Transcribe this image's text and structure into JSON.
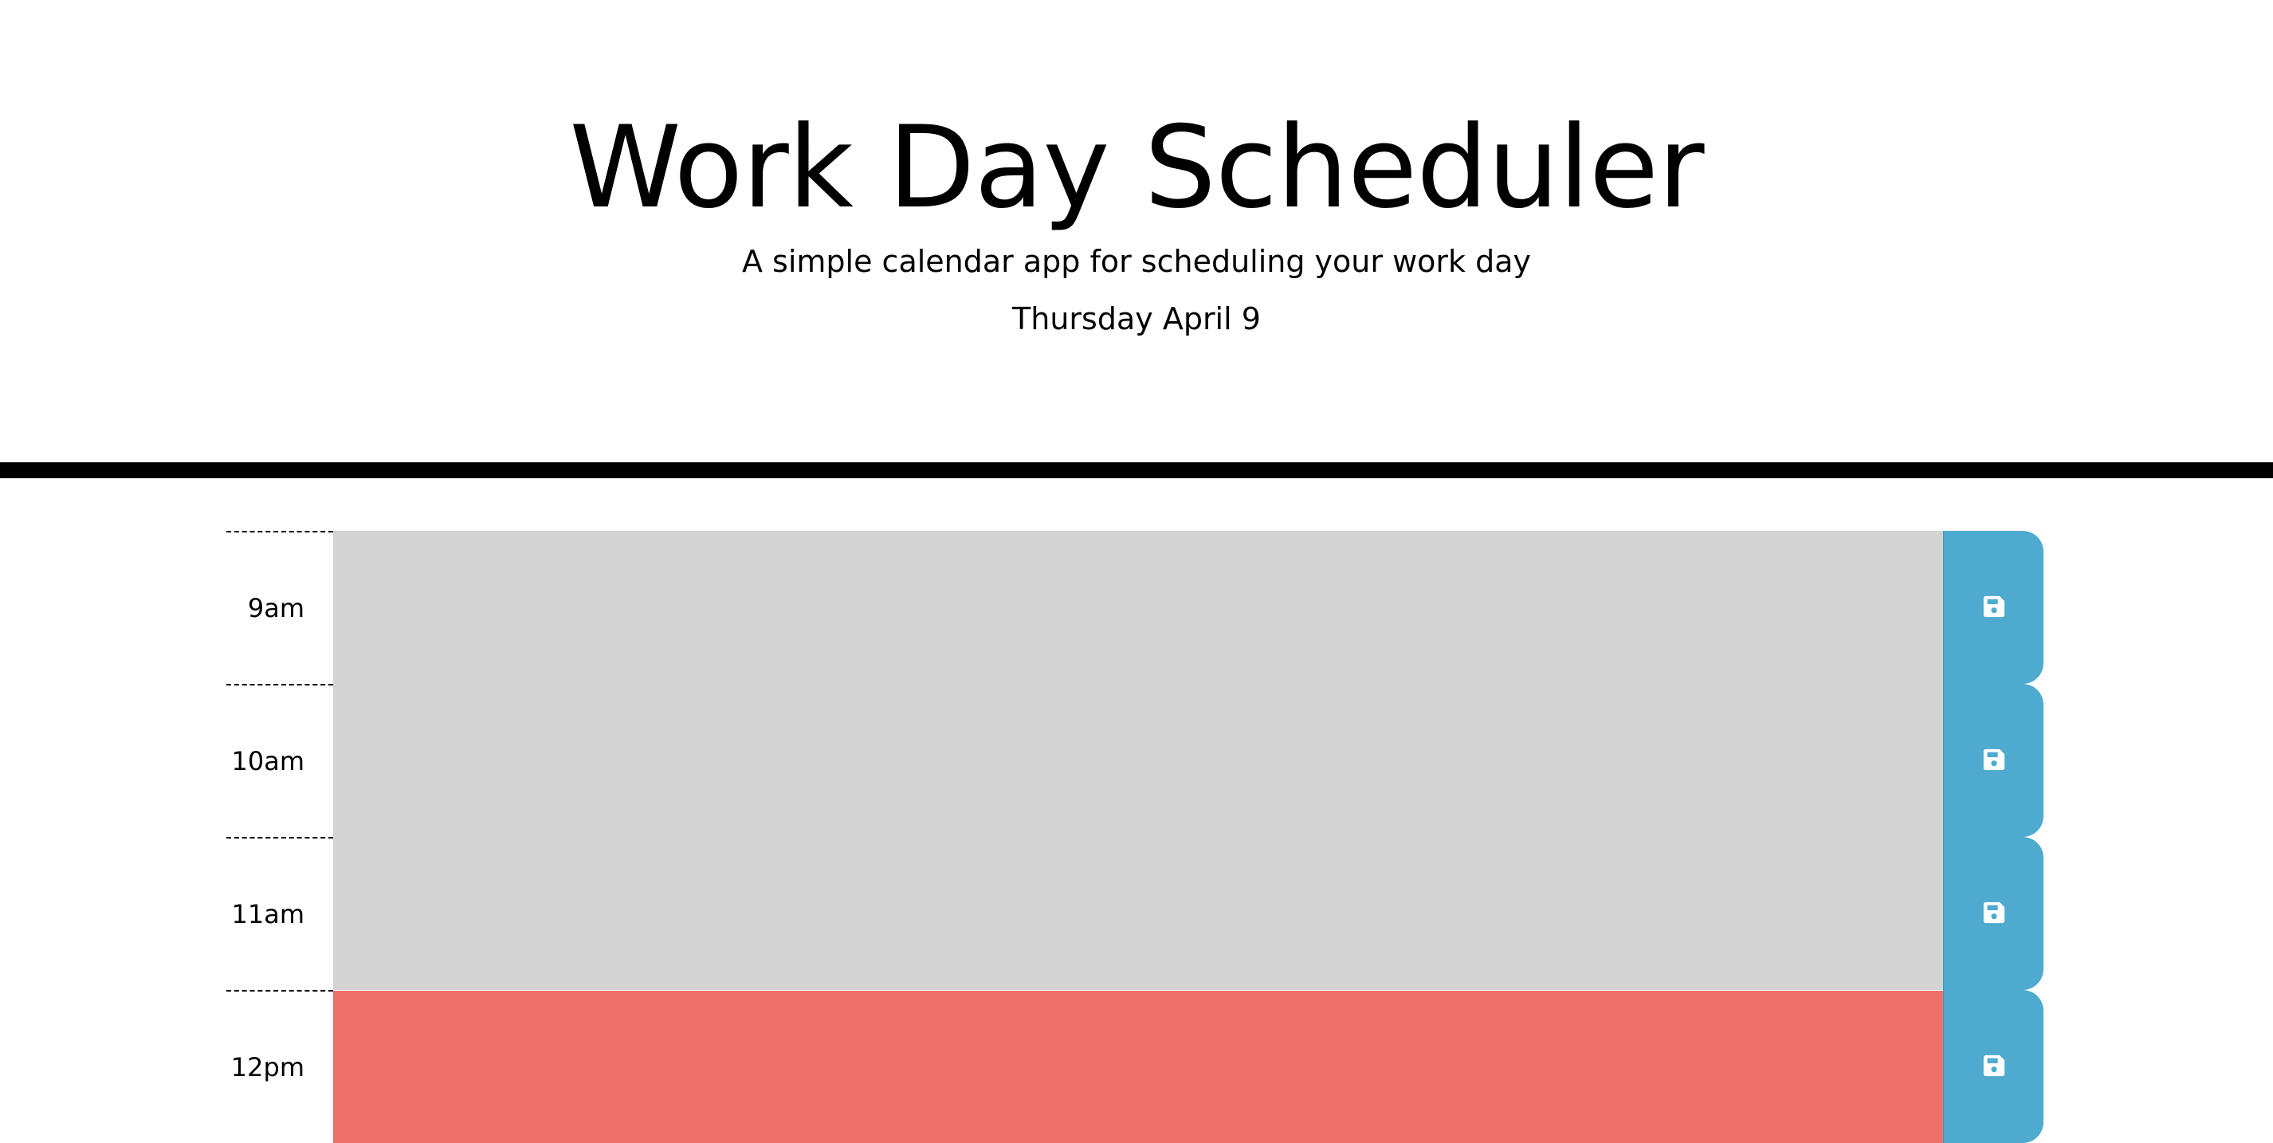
{
  "header": {
    "title": "Work Day Scheduler",
    "subtitle": "A simple calendar app for scheduling your work day",
    "current_day": "Thursday April 9"
  },
  "colors": {
    "past": "#d3d3d3",
    "present": "#ec7069",
    "save_button": "#4eaace",
    "divider": "#000000"
  },
  "time_blocks": [
    {
      "hour": "9am",
      "state": "past",
      "description": "",
      "save_icon": "floppy-disk-icon"
    },
    {
      "hour": "10am",
      "state": "past",
      "description": "",
      "save_icon": "floppy-disk-icon"
    },
    {
      "hour": "11am",
      "state": "past",
      "description": "",
      "save_icon": "floppy-disk-icon"
    },
    {
      "hour": "12pm",
      "state": "present",
      "description": "",
      "save_icon": "floppy-disk-icon"
    }
  ]
}
